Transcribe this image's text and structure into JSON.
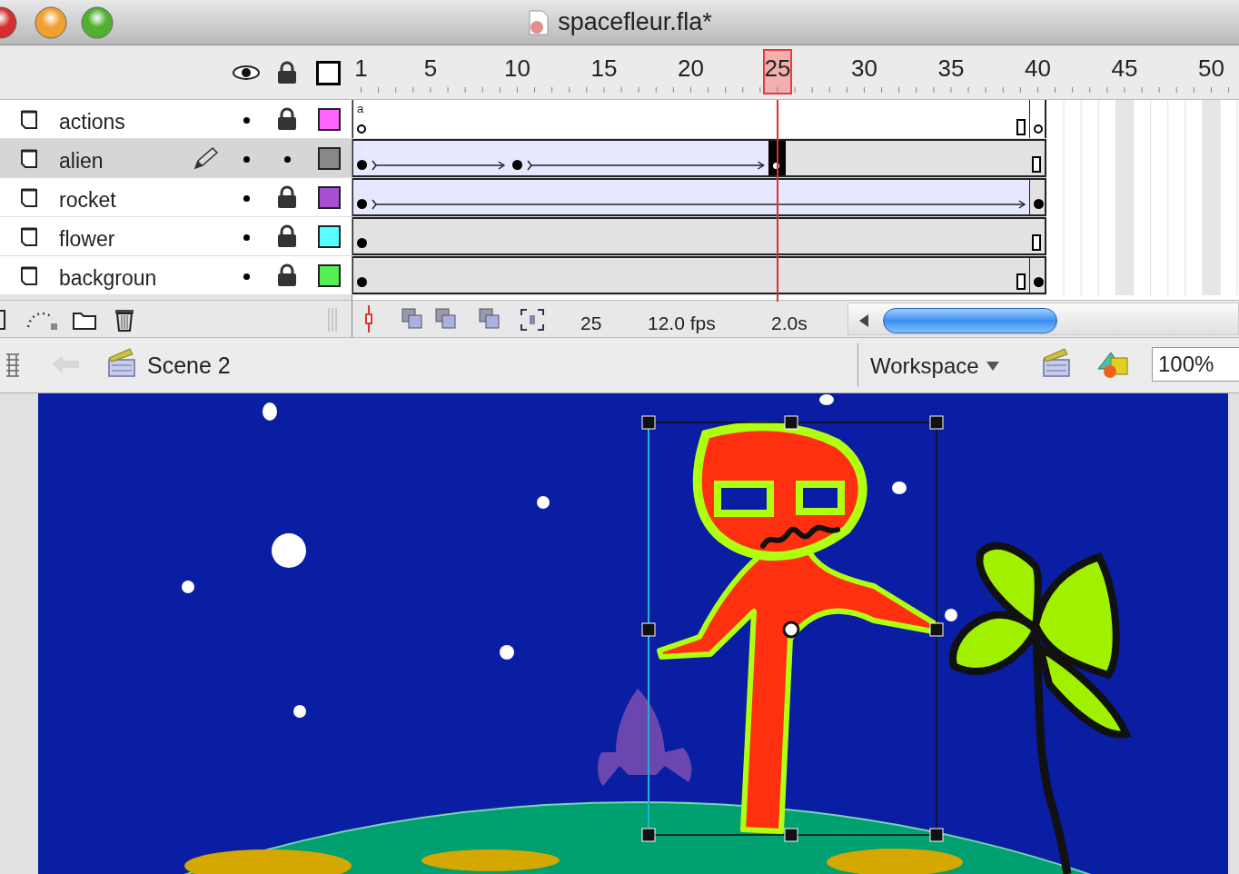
{
  "window": {
    "title": "spacefleur.fla*"
  },
  "timeline": {
    "ruler": [
      "1",
      "5",
      "10",
      "15",
      "20",
      "25",
      "30",
      "35",
      "40",
      "45",
      "50"
    ],
    "layers": [
      {
        "name": "actions",
        "selected": false,
        "editing": false,
        "locked": true,
        "color": "#ff66ff",
        "frame_label": "a",
        "frames": [
          {
            "kind": "empty",
            "selected": false
          },
          {
            "kind": "empty",
            "selected": false
          }
        ]
      },
      {
        "name": "alien",
        "selected": true,
        "editing": true,
        "locked": false,
        "color": "#888888",
        "frames": [
          {
            "kind": "tween",
            "selected": false
          },
          {
            "kind": "tween",
            "selected": false
          },
          {
            "kind": "static",
            "selected": true
          }
        ]
      },
      {
        "name": "rocket",
        "selected": false,
        "editing": false,
        "locked": true,
        "color": "#a64fd0",
        "frames": [
          {
            "kind": "tween",
            "selected": false
          },
          {
            "kind": "static",
            "selected": false
          }
        ]
      },
      {
        "name": "flower",
        "selected": false,
        "editing": false,
        "locked": true,
        "color": "#55ffff",
        "frames": [
          {
            "kind": "static",
            "selected": false
          }
        ]
      },
      {
        "name": "backgroun",
        "selected": false,
        "editing": false,
        "locked": true,
        "color": "#55ee55",
        "frames": [
          {
            "kind": "static",
            "selected": false
          },
          {
            "kind": "static",
            "selected": false
          }
        ]
      }
    ],
    "toolbar": {
      "current_frame": "25",
      "frame_rate": "12.0 fps",
      "elapsed": "2.0s"
    }
  },
  "edit_bar": {
    "scene": "Scene 2",
    "workspace": "Workspace",
    "zoom": "100%"
  }
}
